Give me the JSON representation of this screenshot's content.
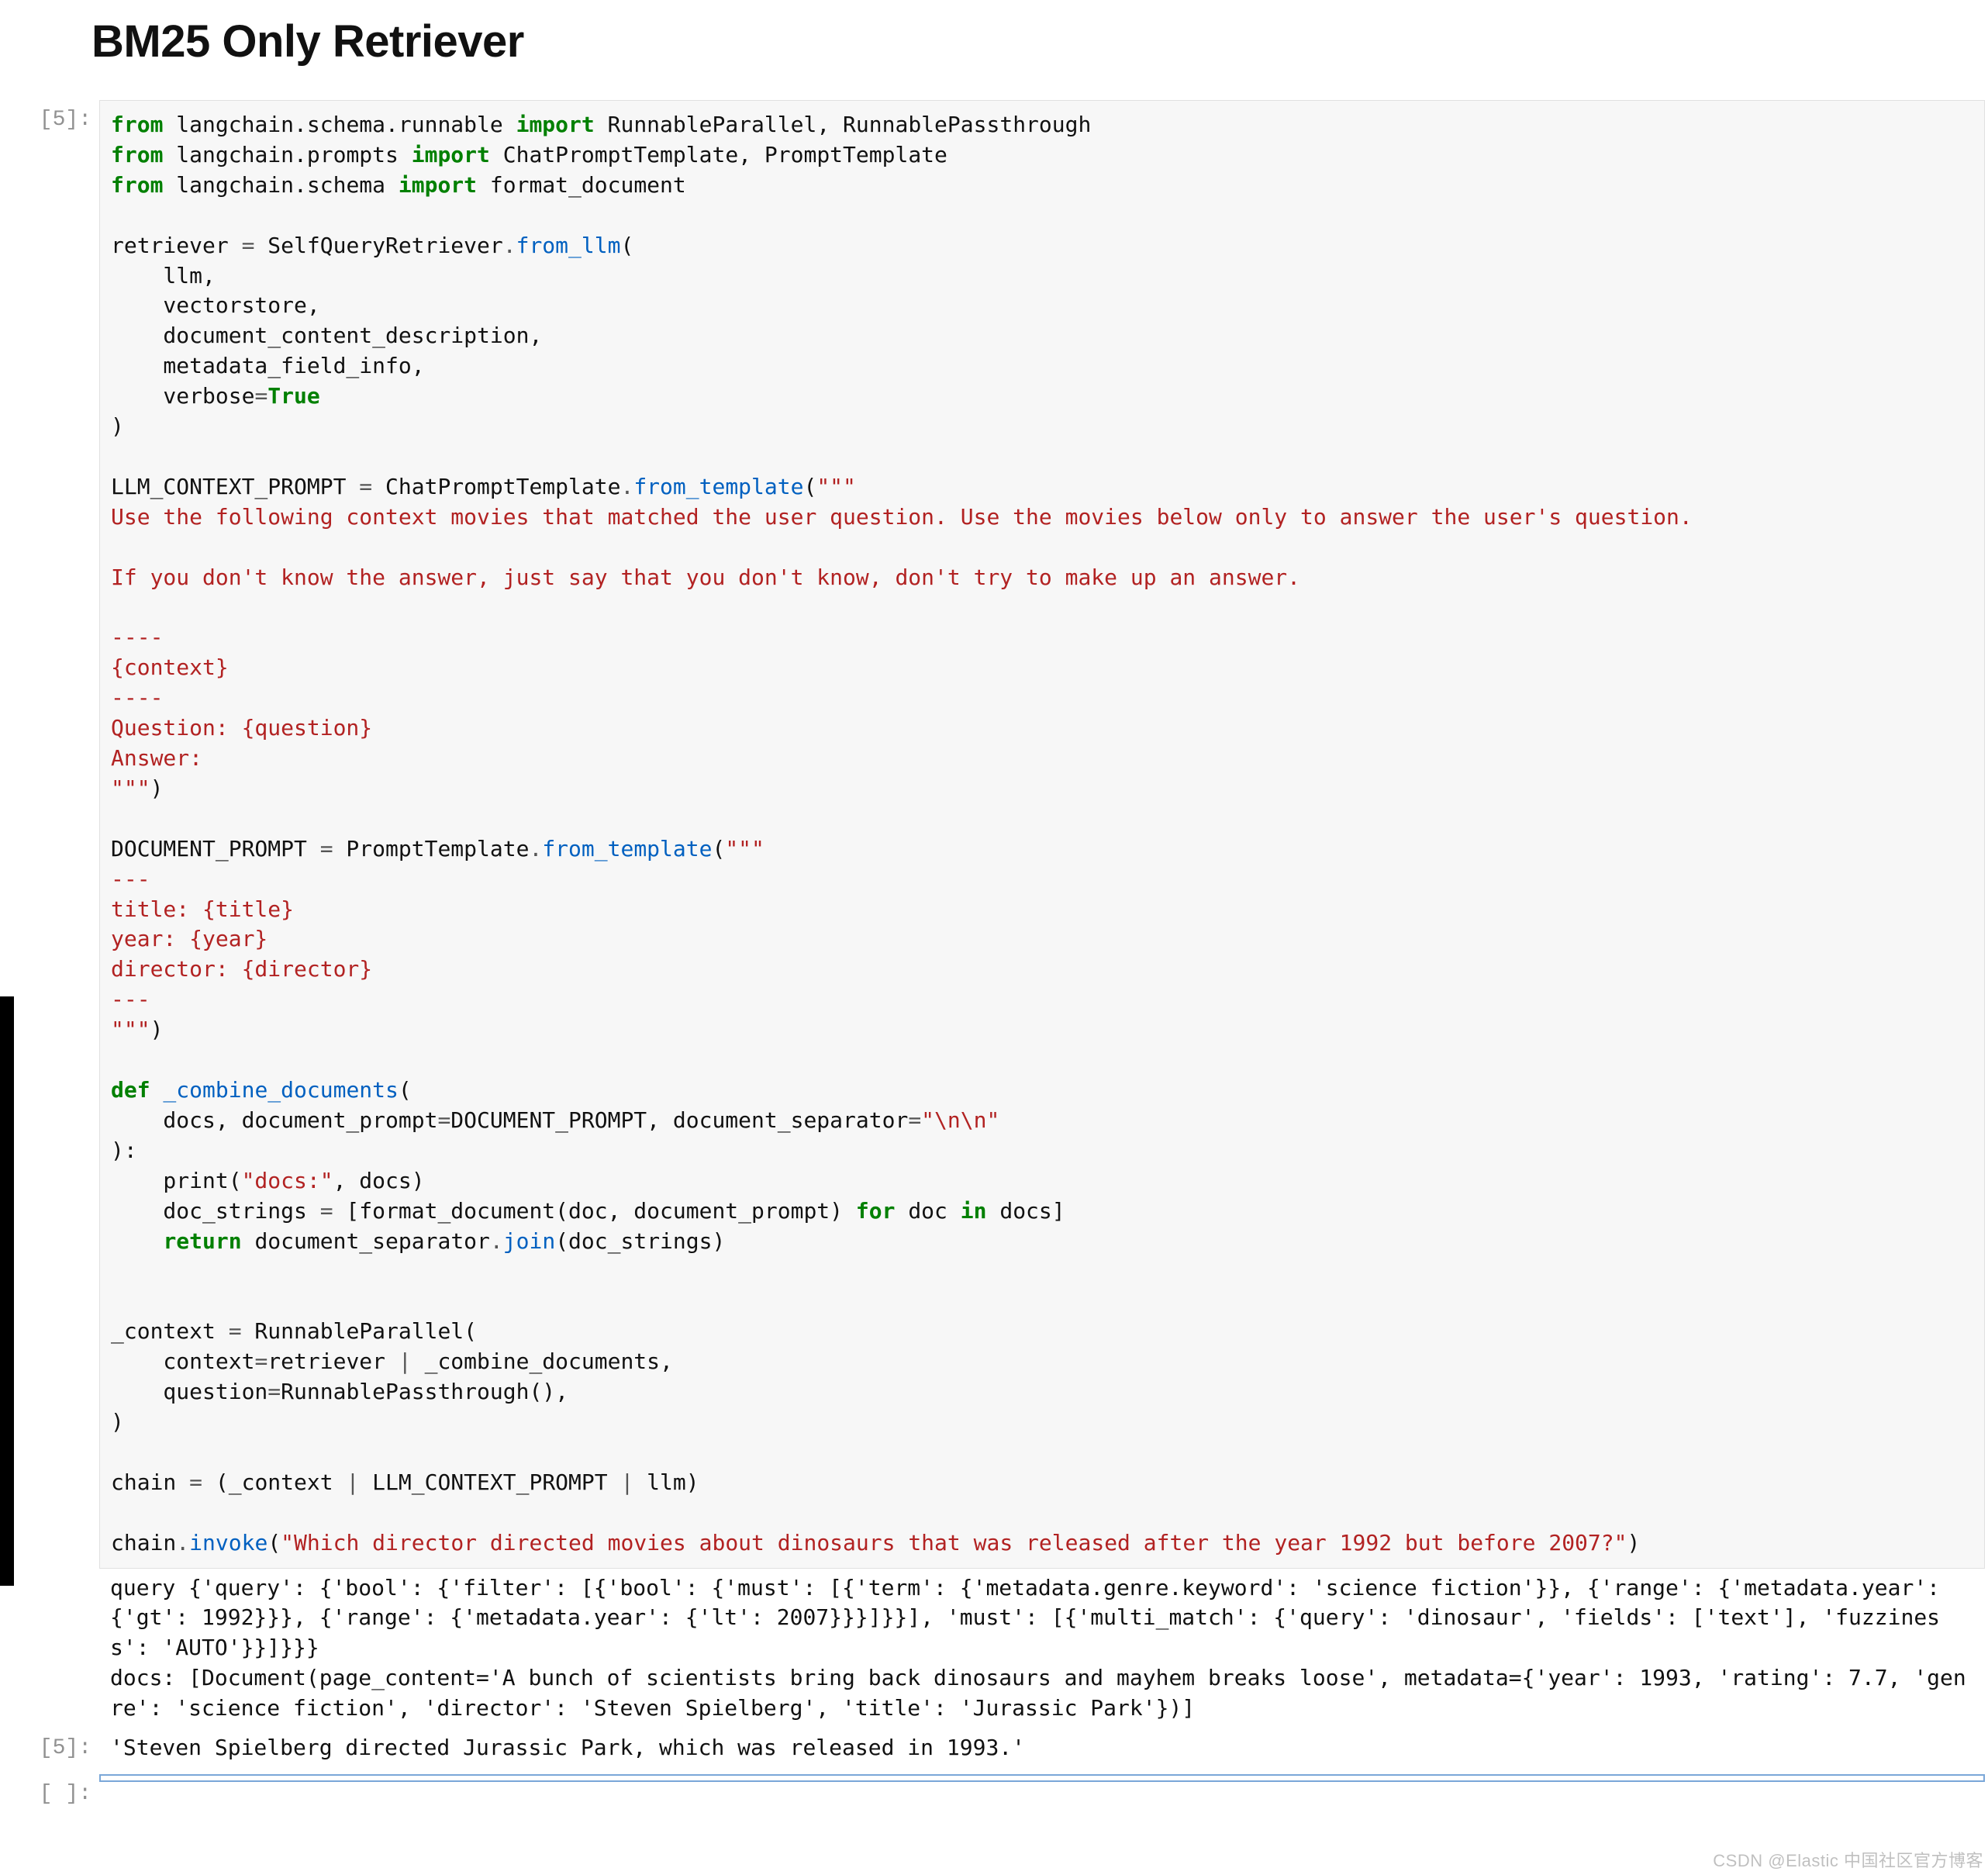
{
  "heading": "BM25 Only Retriever",
  "prompts": {
    "in5": "[5]:",
    "out5": "[5]:",
    "in_next": "[ ]:"
  },
  "code": {
    "line1_from": "from",
    "line1_rest": " langchain.schema.runnable ",
    "line1_import": "import",
    "line1_tail": " RunnableParallel, RunnablePassthrough",
    "line2_from": "from",
    "line2_rest": " langchain.prompts ",
    "line2_import": "import",
    "line2_tail": " ChatPromptTemplate, PromptTemplate",
    "line3_from": "from",
    "line3_rest": " langchain.schema ",
    "line3_import": "import",
    "line3_tail": " format_document",
    "blank": "",
    "retriever_assign_pre": "retriever ",
    "eq": "=",
    "retriever_class": " SelfQueryRetriever",
    "dot": ".",
    "from_llm": "from_llm",
    "lparen": "(",
    "rparen": ")",
    "arg_llm": "    llm,",
    "arg_vectorstore": "    vectorstore,",
    "arg_docdesc": "    document_content_description,",
    "arg_meta": "    metadata_field_info,",
    "arg_verbose_pre": "    verbose",
    "arg_verbose_eq": "=",
    "arg_true": "True",
    "close_paren_line": ")",
    "llm_ctx_assign_pre": "LLM_CONTEXT_PROMPT ",
    "llm_ctx_class": " ChatPromptTemplate",
    "from_template": "from_template",
    "open_triple": "(",
    "triple_start": "\"\"\"",
    "llm_ctx_body": "Use the following context movies that matched the user question. Use the movies below only to answer the user's question.\n\nIf you don't know the answer, just say that you don't know, don't try to make up an answer.\n\n----\n{context}\n----\nQuestion: {question}\nAnswer:\n\"\"\"",
    "close_paren_after_triple": ")",
    "doc_prompt_assign_pre": "DOCUMENT_PROMPT ",
    "doc_prompt_class": " PromptTemplate",
    "doc_prompt_body": "\"\"\"\n---\ntitle: {title}\nyear: {year}\ndirector: {director}\n---\n\"\"\"",
    "def_kw": "def",
    "def_name": " _combine_documents",
    "def_open": "(",
    "def_args1": "    docs, document_prompt",
    "def_args_eq": "=",
    "def_args1b": "DOCUMENT_PROMPT, document_separator",
    "def_args_eq2": "=",
    "def_sep_str": "\"\\n\\n\"",
    "def_close_colon": "):",
    "print_pre": "    print(",
    "print_str": "\"docs:\"",
    "print_tail": ", docs)",
    "docstrings_pre": "    doc_strings ",
    "bracket_open": " [",
    "format_doc_call": "format_document(doc, document_prompt) ",
    "for_kw": "for",
    "for_mid": " doc ",
    "in_kw": "in",
    "for_tail": " docs",
    "bracket_close": "]",
    "return_kw": "return",
    "return_pre": " document_separator",
    "join_call": "join",
    "return_tail": "(doc_strings)",
    "ctx_assign_pre": "_context ",
    "runpar": " RunnableParallel(",
    "ctx_line1_pre": "    context",
    "ctx_line1_mid": "retriever ",
    "pipe": "|",
    "ctx_line1_tail": " _combine_documents,",
    "ctx_line2_pre": "    question",
    "ctx_line2_tail": "RunnablePassthrough(),",
    "chain_assign_pre": "chain ",
    "chain_body_pre": " (_context ",
    "chain_mid1": " LLM_CONTEXT_PROMPT ",
    "chain_mid2": " llm)",
    "chain_invoke_pre": "chain",
    "invoke_call": "invoke",
    "invoke_str": "\"Which director directed movies about dinosaurs that was released after the year 1992 but before 2007?\"",
    "invoke_close": ")"
  },
  "stdout": {
    "query": "query {'query': {'bool': {'filter': [{'bool': {'must': [{'term': {'metadata.genre.keyword': 'science fiction'}}, {'range': {'metadata.year': {'gt': 1992}}}, {'range': {'metadata.year': {'lt': 2007}}}]}}], 'must': [{'multi_match': {'query': 'dinosaur', 'fields': ['text'], 'fuzziness': 'AUTO'}}]}}}",
    "docs": "docs: [Document(page_content='A bunch of scientists bring back dinosaurs and mayhem breaks loose', metadata={'year': 1993, 'rating': 7.7, 'genre': 'science fiction', 'director': 'Steven Spielberg', 'title': 'Jurassic Park'})]"
  },
  "result": "'Steven Spielberg directed Jurassic Park, which was released in 1993.'",
  "watermark": "CSDN @Elastic 中国社区官方博客"
}
